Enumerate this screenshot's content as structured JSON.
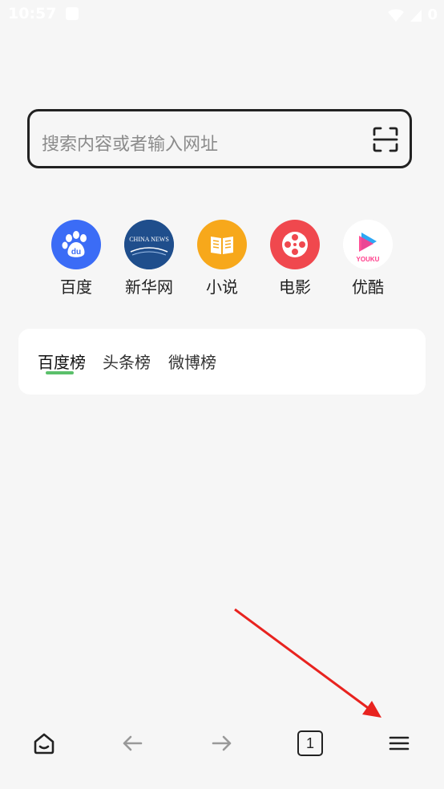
{
  "status_bar": {
    "time": "10:57",
    "battery": "0"
  },
  "search": {
    "placeholder": "搜索内容或者输入网址"
  },
  "quick_links": [
    {
      "label": "百度",
      "icon": "baidu-paw-icon",
      "color": "#3b6cf6"
    },
    {
      "label": "新华网",
      "icon": "china-news-icon",
      "color": "#1f4e8c",
      "logo_text": "CHINA NEWS"
    },
    {
      "label": "小说",
      "icon": "book-icon",
      "color": "#f7a81b"
    },
    {
      "label": "电影",
      "icon": "film-reel-icon",
      "color": "#f0484e"
    },
    {
      "label": "优酷",
      "icon": "youku-play-icon",
      "color": "#ffffff",
      "logo_text": "YOUKU"
    }
  ],
  "hot_tabs": [
    {
      "label": "百度榜",
      "active": true
    },
    {
      "label": "头条榜",
      "active": false
    },
    {
      "label": "微博榜",
      "active": false
    }
  ],
  "bottom_nav": {
    "tab_count": "1"
  },
  "colors": {
    "accent": "#5bc06b",
    "arrow": "#e8231f"
  }
}
